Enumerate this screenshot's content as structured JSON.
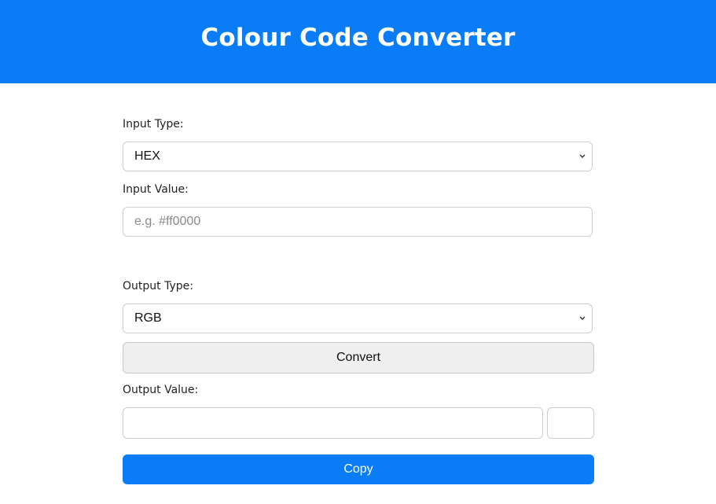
{
  "header": {
    "title": "Colour Code Converter",
    "background": "#0a7cf5"
  },
  "form": {
    "input_type_label": "Input Type:",
    "input_type_selected": "HEX",
    "input_value_label": "Input Value:",
    "input_value_value": "",
    "input_value_placeholder": "e.g. #ff0000",
    "output_type_label": "Output Type:",
    "output_type_selected": "RGB",
    "convert_label": "Convert",
    "output_value_label": "Output Value:",
    "output_value_value": "",
    "copy_label": "Copy"
  },
  "colors": {
    "accent": "#0a7cf5",
    "convert_bg": "#efefef",
    "border": "#cfcfcf"
  },
  "icons": {
    "select_arrow": "chevron-down-icon"
  }
}
